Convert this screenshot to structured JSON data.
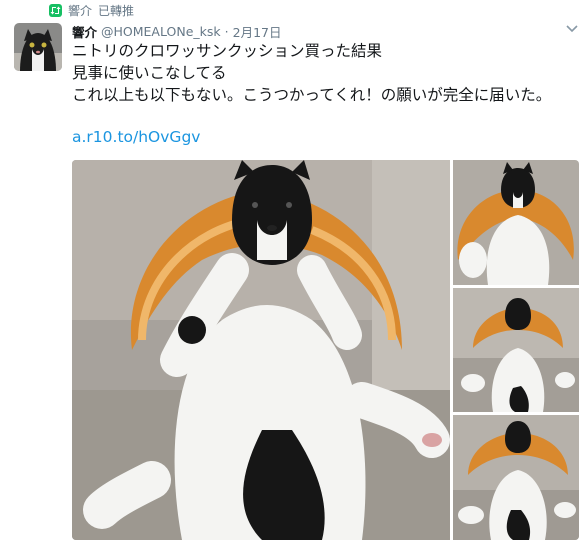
{
  "retweet": {
    "label": "已轉推",
    "retweeter": "響介",
    "icon": "retweet-icon"
  },
  "tweet": {
    "author": {
      "name": "響介",
      "handle": "@HOMEALONe_ksk",
      "separator": "·",
      "date": "2月17日"
    },
    "text_lines": [
      "ニトリのクロワッサンクッション買った結果",
      "見事に使いこなしてる",
      "これ以上も以下もない。こうつかってくれ！の願いが完全に届いた。"
    ],
    "link": "a.r10.to/hOvGgv"
  },
  "colors": {
    "accent": "#1b95e0",
    "retweet_green": "#17bf63",
    "muted": "#657786"
  },
  "media": {
    "photo_count": 4
  }
}
